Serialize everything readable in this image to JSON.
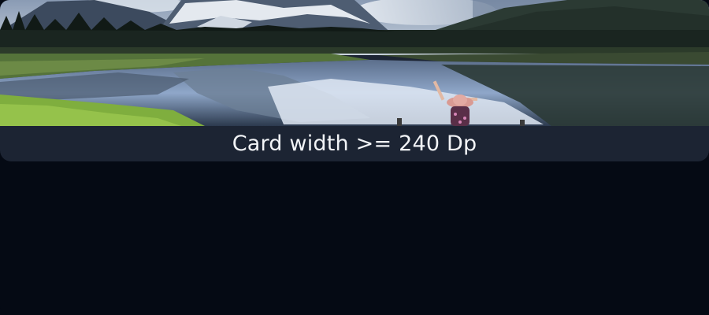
{
  "card": {
    "image_icon": "landscape-photo",
    "caption": "Card width >= 240 Dp"
  },
  "colors": {
    "page_background": "#050a14",
    "card_background": "#1c2433",
    "caption_text": "#f2f4f7"
  }
}
